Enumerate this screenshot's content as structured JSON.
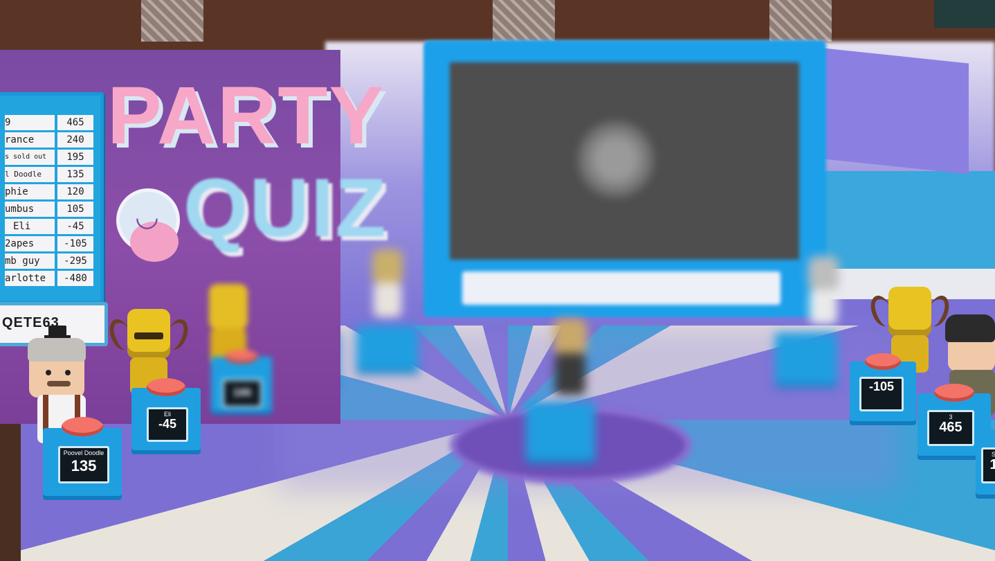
{
  "scoreboard": {
    "rows": [
      {
        "name": "9",
        "score": "465"
      },
      {
        "name": "rance",
        "score": "240"
      },
      {
        "name": "s sold out",
        "score": "195"
      },
      {
        "name": "l Doodle",
        "score": "135"
      },
      {
        "name": "phie",
        "score": "120"
      },
      {
        "name": "umbus",
        "score": "105"
      },
      {
        "name": "Eli",
        "score": "-45"
      },
      {
        "name": "2apes",
        "score": "-105"
      },
      {
        "name": "mb guy",
        "score": "-295"
      },
      {
        "name": "arlotte",
        "score": "-480"
      }
    ]
  },
  "room_code": "QETE63",
  "logo": {
    "line1": "PARTY",
    "line2": "QUIZ"
  },
  "podiums": [
    {
      "name": "Poovel Doodle",
      "score": "135"
    },
    {
      "name": "Eli",
      "score": "-45"
    },
    {
      "name": "2apes",
      "score": "-105"
    },
    {
      "name": "3",
      "score": "465"
    },
    {
      "name": "S",
      "score": "1"
    }
  ],
  "colors": {
    "podium_blue": "#1f9fe0",
    "buzzer_red": "#f47368",
    "logo_pink": "#f7a7c8",
    "logo_blue": "#9fd8f0",
    "box_purple": "#7a4ba3"
  }
}
